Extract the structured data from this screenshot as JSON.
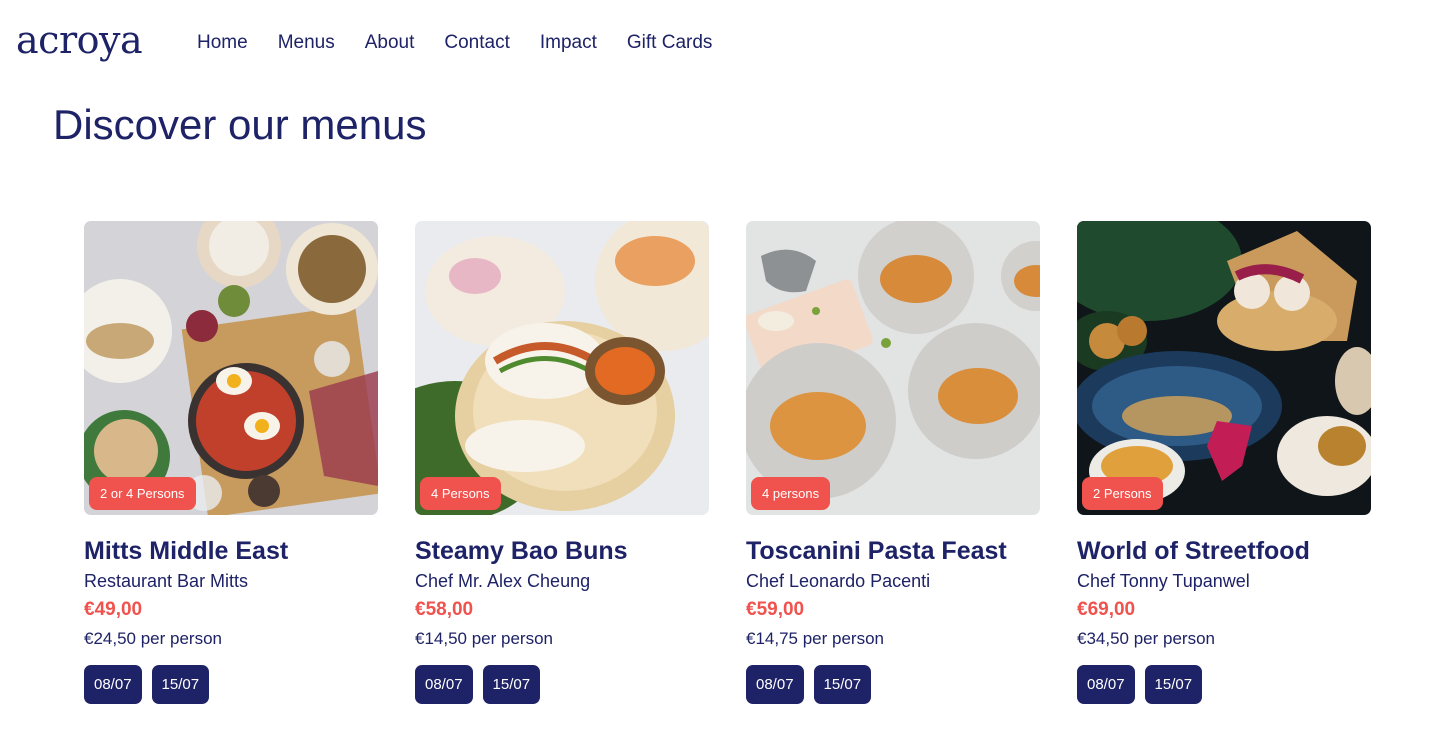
{
  "header": {
    "logo": "acroya",
    "nav": [
      "Home",
      "Menus",
      "About",
      "Contact",
      "Impact",
      "Gift Cards"
    ]
  },
  "page": {
    "title": "Discover our menus"
  },
  "cards": [
    {
      "badge": "2 or 4 Persons",
      "title": "Mitts Middle East",
      "chef": "Restaurant Bar Mitts",
      "price": "€49,00",
      "per_person": "€24,50 per person",
      "dates": [
        "08/07",
        "15/07"
      ]
    },
    {
      "badge": "4 Persons",
      "title": "Steamy Bao Buns",
      "chef": "Chef Mr. Alex Cheung",
      "price": "€58,00",
      "per_person": "€14,50 per person",
      "dates": [
        "08/07",
        "15/07"
      ]
    },
    {
      "badge": "4 persons",
      "title": "Toscanini Pasta Feast",
      "chef": "Chef Leonardo Pacenti",
      "price": "€59,00",
      "per_person": "€14,75 per person",
      "dates": [
        "08/07",
        "15/07"
      ]
    },
    {
      "badge": "2 Persons",
      "title": "World of Streetfood",
      "chef": "Chef Tonny Tupanwel",
      "price": "€69,00",
      "per_person": "€34,50 per person",
      "dates": [
        "08/07",
        "15/07"
      ]
    }
  ],
  "colors": {
    "navy": "#1e2266",
    "coral": "#f0524d"
  }
}
